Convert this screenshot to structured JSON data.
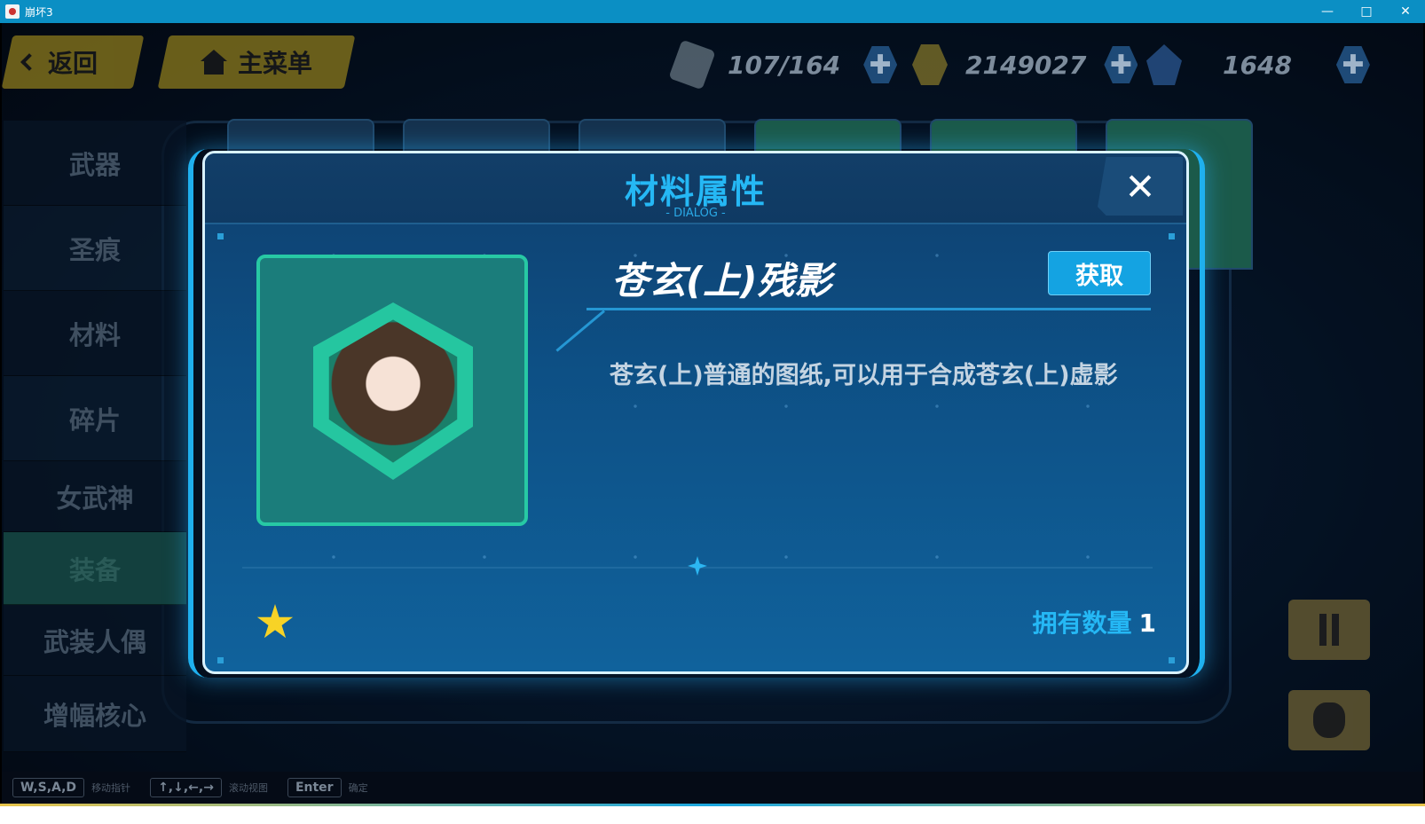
{
  "window": {
    "title": "崩坏3",
    "minimize": "—",
    "maximize": "□",
    "close": "✕"
  },
  "topbar": {
    "back_label": "返回",
    "main_menu_label": "主菜单",
    "resources": [
      {
        "icon": "stamina-icon",
        "value": "107/164"
      },
      {
        "icon": "coin-icon",
        "value": "2149027"
      },
      {
        "icon": "crystal-icon",
        "value": "1648"
      }
    ],
    "plus": "✚"
  },
  "sidebar": {
    "items": [
      {
        "label": "武器"
      },
      {
        "label": "圣痕"
      },
      {
        "label": "材料"
      },
      {
        "label": "碎片"
      },
      {
        "label": "女武神"
      },
      {
        "label": "装备"
      },
      {
        "label": "武装人偶"
      },
      {
        "label": "增幅核心"
      }
    ],
    "active_index": 5
  },
  "dialog": {
    "title": "材料属性",
    "subtitle": "- DIALOG -",
    "close": "✕",
    "item_name": "苍玄(上)残影",
    "acquire_label": "获取",
    "description": "苍玄(上)普通的图纸,可以用于合成苍玄(上)虚影",
    "rarity_stars": 1,
    "owned_label": "拥有数量",
    "owned_count": "1"
  },
  "hints": [
    {
      "key": "W,S,A,D",
      "text": "移动指针"
    },
    {
      "key": "↑,↓,←,→",
      "text": "滚动视图"
    },
    {
      "key": "Enter",
      "text": "确定"
    }
  ],
  "colors": {
    "accent": "#25b8f5",
    "dialog_border": "#d9f2ff",
    "item_frame": "#27c9a4",
    "star": "#f7d326",
    "titlebar": "#0b8fc4"
  }
}
